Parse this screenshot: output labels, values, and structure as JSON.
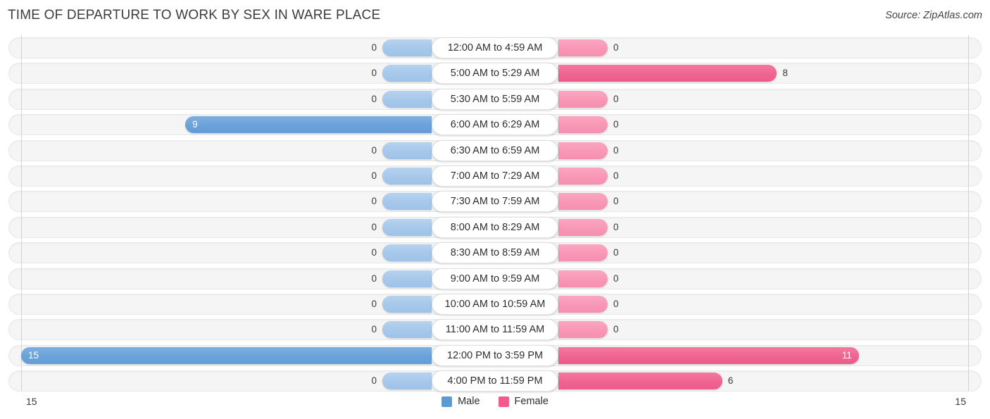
{
  "header": {
    "title": "TIME OF DEPARTURE TO WORK BY SEX IN WARE PLACE",
    "source": "Source: ZipAtlas.com"
  },
  "legend": {
    "male_label": "Male",
    "female_label": "Female",
    "male_color": "#5b9bd5",
    "female_color": "#ef5c8c"
  },
  "axis": {
    "left_tick": "15",
    "right_tick": "15",
    "max": 15
  },
  "chart_data": {
    "type": "bar",
    "orientation": "horizontal-diverging",
    "title": "TIME OF DEPARTURE TO WORK BY SEX IN WARE PLACE",
    "xlabel": "",
    "ylabel": "",
    "xlim": [
      15,
      15
    ],
    "grid": false,
    "legend_position": "bottom-center",
    "categories": [
      "12:00 AM to 4:59 AM",
      "5:00 AM to 5:29 AM",
      "5:30 AM to 5:59 AM",
      "6:00 AM to 6:29 AM",
      "6:30 AM to 6:59 AM",
      "7:00 AM to 7:29 AM",
      "7:30 AM to 7:59 AM",
      "8:00 AM to 8:29 AM",
      "8:30 AM to 8:59 AM",
      "9:00 AM to 9:59 AM",
      "10:00 AM to 10:59 AM",
      "11:00 AM to 11:59 AM",
      "12:00 PM to 3:59 PM",
      "4:00 PM to 11:59 PM"
    ],
    "series": [
      {
        "name": "Male",
        "color": "#5b9bd5",
        "values": [
          0,
          0,
          0,
          9,
          0,
          0,
          0,
          0,
          0,
          0,
          0,
          0,
          15,
          0
        ]
      },
      {
        "name": "Female",
        "color": "#ef5c8c",
        "values": [
          0,
          8,
          0,
          0,
          0,
          0,
          0,
          0,
          0,
          0,
          0,
          0,
          11,
          6
        ]
      }
    ]
  }
}
